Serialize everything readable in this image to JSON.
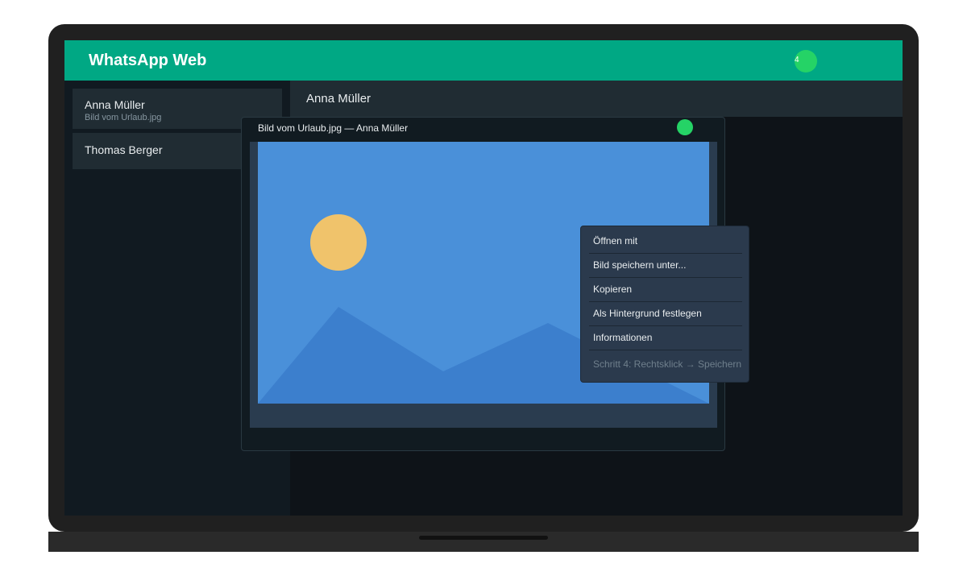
{
  "app": {
    "title": "WhatsApp Web",
    "badge_count": "4",
    "accent_color": "#00a884",
    "badge_color": "#25d366"
  },
  "sidebar": {
    "chats": [
      {
        "name": "Anna Müller",
        "preview": "Bild vom Urlaub.jpg"
      },
      {
        "name": "Thomas Berger"
      }
    ]
  },
  "conversation": {
    "contact_name": "Anna Müller"
  },
  "viewer": {
    "title": "Bild vom Urlaub.jpg — Anna Müller",
    "image_icons": [
      "sun-icon",
      "mountains-icon"
    ]
  },
  "context_menu": {
    "items": [
      {
        "label": "Öffnen mit"
      },
      {
        "label": "Bild speichern unter..."
      },
      {
        "label": "Kopieren"
      },
      {
        "label": "Als Hintergrund festlegen"
      },
      {
        "label": "Informationen"
      }
    ],
    "hint": "Schritt 4: Rechtsklick → Speichern"
  }
}
